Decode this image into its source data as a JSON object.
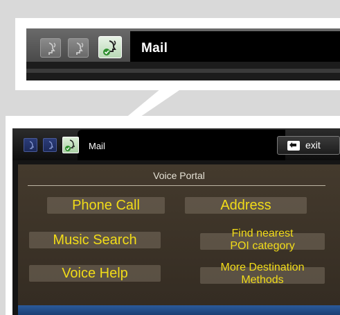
{
  "callout": {
    "tab_label": "Mail",
    "icons": [
      "voice-icon",
      "voice-icon",
      "voice-checked-icon"
    ]
  },
  "screen": {
    "tab_label": "Mail",
    "exit_label": "exit",
    "portal_title": "Voice Portal",
    "options": {
      "phone_call": "Phone Call",
      "address": "Address",
      "music_search": "Music Search",
      "find_nearest_1": "Find nearest",
      "find_nearest_2": "POI category",
      "voice_help": "Voice Help",
      "more_dest_1": "More Destination",
      "more_dest_2": "Methods"
    }
  },
  "colors": {
    "option_text": "#f2dc18",
    "portal_bg": "#3a3126",
    "active_icon": "#b9d9b6"
  }
}
